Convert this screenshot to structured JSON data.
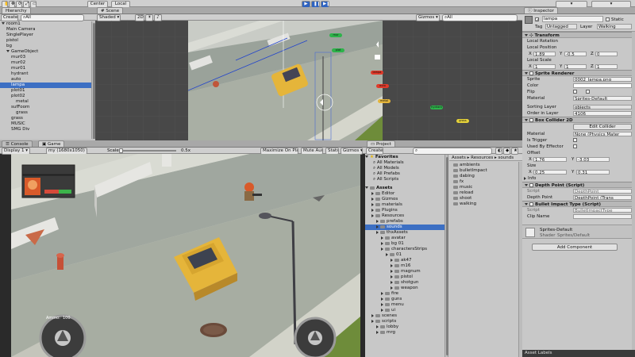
{
  "toolbar": {
    "center": "Center",
    "local": "Local"
  },
  "hierarchy": {
    "title": "Hierarchy",
    "create": "Create",
    "search_placeholder": "All",
    "items": [
      {
        "label": "room1",
        "indent": 0,
        "expanded": true,
        "selected": false
      },
      {
        "label": "Main Camera",
        "indent": 1,
        "expanded": false,
        "selected": false
      },
      {
        "label": "SinglePlayer",
        "indent": 1,
        "expanded": false,
        "selected": false
      },
      {
        "label": "pistol",
        "indent": 1,
        "expanded": false,
        "selected": false
      },
      {
        "label": "bg",
        "indent": 1,
        "expanded": false,
        "selected": false
      },
      {
        "label": "GameObject",
        "indent": 1,
        "expanded": true,
        "selected": false
      },
      {
        "label": "mur03",
        "indent": 2,
        "expanded": false,
        "selected": false
      },
      {
        "label": "mur02",
        "indent": 2,
        "expanded": false,
        "selected": false
      },
      {
        "label": "mur01",
        "indent": 2,
        "expanded": false,
        "selected": false
      },
      {
        "label": "hydrant",
        "indent": 2,
        "expanded": false,
        "selected": false
      },
      {
        "label": "auto",
        "indent": 2,
        "expanded": false,
        "selected": false
      },
      {
        "label": "lampa",
        "indent": 2,
        "expanded": false,
        "selected": true
      },
      {
        "label": "plot01",
        "indent": 2,
        "expanded": false,
        "selected": false
      },
      {
        "label": "plot02",
        "indent": 2,
        "expanded": false,
        "selected": false
      },
      {
        "label": "metal",
        "indent": 3,
        "expanded": false,
        "selected": false
      },
      {
        "label": "sufFoom",
        "indent": 2,
        "expanded": false,
        "selected": false
      },
      {
        "label": "grass",
        "indent": 3,
        "expanded": false,
        "selected": false
      },
      {
        "label": "grass",
        "indent": 2,
        "expanded": false,
        "selected": false
      },
      {
        "label": "MUSIC",
        "indent": 2,
        "expanded": false,
        "selected": false
      },
      {
        "label": "SMG Div",
        "indent": 2,
        "expanded": false,
        "selected": false
      }
    ]
  },
  "scene": {
    "title": "Scene",
    "shaded": "Shaded",
    "gizmos": "Gizmos",
    "search_placeholder": "All",
    "labels": [
      "mur",
      "plot",
      "lampa",
      "auto",
      "metal",
      "hydrant",
      "grass"
    ]
  },
  "game": {
    "console_tab": "Console",
    "game_tab": "Game",
    "display": "Display 1",
    "resolution": "my (1680x1050)",
    "scale_label": "Scale",
    "scale_value": "0.5x",
    "maximize": "Maximize On Play",
    "mute": "Mute Audio",
    "stats": "Stats",
    "gizmos": "Gizmos",
    "hud_ammo_label": "Ammo:",
    "hud_ammo_value": "100"
  },
  "project": {
    "title": "Project",
    "create": "Create",
    "breadcrumb": [
      "Assets",
      "Resources",
      "sounds"
    ],
    "favorites_title": "Favorites",
    "favorites": [
      "All Materials",
      "All Models",
      "All Prefabs",
      "All Scripts"
    ],
    "assets_title": "Assets",
    "tree": [
      {
        "label": "Editor",
        "indent": 1,
        "selected": false
      },
      {
        "label": "Gizmos",
        "indent": 1,
        "selected": false
      },
      {
        "label": "materials",
        "indent": 1,
        "selected": false
      },
      {
        "label": "Plugins",
        "indent": 1,
        "selected": false
      },
      {
        "label": "Resources",
        "indent": 1,
        "selected": false
      },
      {
        "label": "prefabs",
        "indent": 2,
        "selected": false
      },
      {
        "label": "sounds",
        "indent": 2,
        "selected": true
      },
      {
        "label": "thxAssets",
        "indent": 2,
        "selected": false
      },
      {
        "label": "avatar",
        "indent": 3,
        "selected": false
      },
      {
        "label": "bg 01",
        "indent": 3,
        "selected": false
      },
      {
        "label": "charactersStrips",
        "indent": 3,
        "selected": false
      },
      {
        "label": "01",
        "indent": 4,
        "selected": false
      },
      {
        "label": "ak47",
        "indent": 5,
        "selected": false
      },
      {
        "label": "m16",
        "indent": 5,
        "selected": false
      },
      {
        "label": "magnum",
        "indent": 5,
        "selected": false
      },
      {
        "label": "pistol",
        "indent": 5,
        "selected": false
      },
      {
        "label": "shotgun",
        "indent": 5,
        "selected": false
      },
      {
        "label": "weapon",
        "indent": 5,
        "selected": false
      },
      {
        "label": "fire",
        "indent": 3,
        "selected": false
      },
      {
        "label": "guns",
        "indent": 3,
        "selected": false
      },
      {
        "label": "menu",
        "indent": 3,
        "selected": false
      },
      {
        "label": "ui",
        "indent": 3,
        "selected": false
      },
      {
        "label": "scenes",
        "indent": 1,
        "selected": false
      },
      {
        "label": "scripts",
        "indent": 1,
        "selected": false
      },
      {
        "label": "lobby",
        "indent": 2,
        "selected": false
      },
      {
        "label": "mrg",
        "indent": 2,
        "selected": false
      }
    ],
    "contents": [
      "ambients",
      "bulletImpact",
      "dabing",
      "fx",
      "music",
      "reload",
      "shoot",
      "walking"
    ]
  },
  "inspector": {
    "title": "Inspector",
    "object_name": "lampa",
    "static_label": "Static",
    "tag_label": "Tag",
    "tag_value": "Untagged",
    "layer_label": "Layer",
    "layer_value": "Walking",
    "transform": {
      "title": "Transform",
      "local_rotation": "Local Rotation",
      "local_position": "Local Position",
      "local_scale": "Local Scale",
      "pos": {
        "x": "1.89",
        "y": "-0.5",
        "z": "0"
      },
      "scale": {
        "x": "1",
        "y": "1",
        "z": "1"
      }
    },
    "sprite_renderer": {
      "title": "Sprite Renderer",
      "sprite_label": "Sprite",
      "sprite_value": "0002_lampa.png",
      "color_label": "Color",
      "flip_label": "Flip",
      "material_label": "Material",
      "material_value": "Sprites-Default",
      "sorting_layer_label": "Sorting Layer",
      "sorting_layer_value": "objects",
      "order_label": "Order in Layer",
      "order_value": "4106"
    },
    "box_collider": {
      "title": "Box Collider 2D",
      "edit_collider": "Edit Collider",
      "material_label": "Material",
      "material_value": "None (Physics Mater",
      "is_trigger": "Is Trigger",
      "used_by_effector": "Used By Effector",
      "offset_label": "Offset",
      "offset": {
        "x": "1.76",
        "y": "-3.03"
      },
      "size_label": "Size",
      "size": {
        "x": "0.25",
        "y": "0.31"
      },
      "info": "Info"
    },
    "depth_point": {
      "title": "Depth Point (Script)",
      "script_label": "Script",
      "script_value": "DepthPoint",
      "depth_label": "Depth Point",
      "depth_value": "DepthPoint (Trans"
    },
    "bullet_impact": {
      "title": "Bullet Impact Type (Script)",
      "script_label": "Script",
      "script_value": "BulletImpactType",
      "clip_label": "Clip Name"
    },
    "material_block": {
      "name": "Sprites-Default",
      "shader_label": "Shader",
      "shader_value": "Sprites/Default"
    },
    "add_component": "Add Component",
    "asset_labels": "Asset Labels"
  },
  "colors": {
    "selection": "#3c6fc3",
    "scene_bg": "#484848",
    "road": "#9aa29a",
    "car": "#e5b53a",
    "grass": "#6e8c3a"
  }
}
